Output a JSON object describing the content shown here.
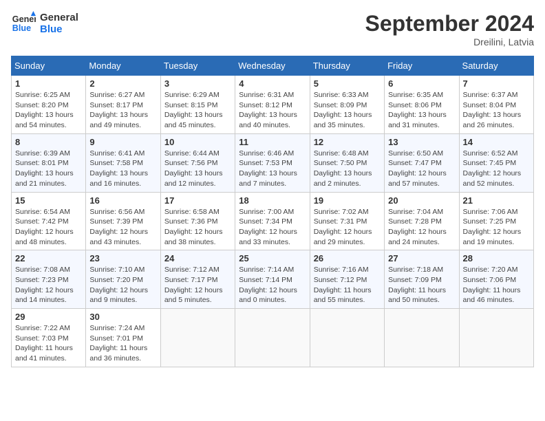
{
  "logo": {
    "line1": "General",
    "line2": "Blue"
  },
  "title": "September 2024",
  "location": "Dreilini, Latvia",
  "days_of_week": [
    "Sunday",
    "Monday",
    "Tuesday",
    "Wednesday",
    "Thursday",
    "Friday",
    "Saturday"
  ],
  "weeks": [
    [
      {
        "day": "1",
        "info": "Sunrise: 6:25 AM\nSunset: 8:20 PM\nDaylight: 13 hours\nand 54 minutes."
      },
      {
        "day": "2",
        "info": "Sunrise: 6:27 AM\nSunset: 8:17 PM\nDaylight: 13 hours\nand 49 minutes."
      },
      {
        "day": "3",
        "info": "Sunrise: 6:29 AM\nSunset: 8:15 PM\nDaylight: 13 hours\nand 45 minutes."
      },
      {
        "day": "4",
        "info": "Sunrise: 6:31 AM\nSunset: 8:12 PM\nDaylight: 13 hours\nand 40 minutes."
      },
      {
        "day": "5",
        "info": "Sunrise: 6:33 AM\nSunset: 8:09 PM\nDaylight: 13 hours\nand 35 minutes."
      },
      {
        "day": "6",
        "info": "Sunrise: 6:35 AM\nSunset: 8:06 PM\nDaylight: 13 hours\nand 31 minutes."
      },
      {
        "day": "7",
        "info": "Sunrise: 6:37 AM\nSunset: 8:04 PM\nDaylight: 13 hours\nand 26 minutes."
      }
    ],
    [
      {
        "day": "8",
        "info": "Sunrise: 6:39 AM\nSunset: 8:01 PM\nDaylight: 13 hours\nand 21 minutes."
      },
      {
        "day": "9",
        "info": "Sunrise: 6:41 AM\nSunset: 7:58 PM\nDaylight: 13 hours\nand 16 minutes."
      },
      {
        "day": "10",
        "info": "Sunrise: 6:44 AM\nSunset: 7:56 PM\nDaylight: 13 hours\nand 12 minutes."
      },
      {
        "day": "11",
        "info": "Sunrise: 6:46 AM\nSunset: 7:53 PM\nDaylight: 13 hours\nand 7 minutes."
      },
      {
        "day": "12",
        "info": "Sunrise: 6:48 AM\nSunset: 7:50 PM\nDaylight: 13 hours\nand 2 minutes."
      },
      {
        "day": "13",
        "info": "Sunrise: 6:50 AM\nSunset: 7:47 PM\nDaylight: 12 hours\nand 57 minutes."
      },
      {
        "day": "14",
        "info": "Sunrise: 6:52 AM\nSunset: 7:45 PM\nDaylight: 12 hours\nand 52 minutes."
      }
    ],
    [
      {
        "day": "15",
        "info": "Sunrise: 6:54 AM\nSunset: 7:42 PM\nDaylight: 12 hours\nand 48 minutes."
      },
      {
        "day": "16",
        "info": "Sunrise: 6:56 AM\nSunset: 7:39 PM\nDaylight: 12 hours\nand 43 minutes."
      },
      {
        "day": "17",
        "info": "Sunrise: 6:58 AM\nSunset: 7:36 PM\nDaylight: 12 hours\nand 38 minutes."
      },
      {
        "day": "18",
        "info": "Sunrise: 7:00 AM\nSunset: 7:34 PM\nDaylight: 12 hours\nand 33 minutes."
      },
      {
        "day": "19",
        "info": "Sunrise: 7:02 AM\nSunset: 7:31 PM\nDaylight: 12 hours\nand 29 minutes."
      },
      {
        "day": "20",
        "info": "Sunrise: 7:04 AM\nSunset: 7:28 PM\nDaylight: 12 hours\nand 24 minutes."
      },
      {
        "day": "21",
        "info": "Sunrise: 7:06 AM\nSunset: 7:25 PM\nDaylight: 12 hours\nand 19 minutes."
      }
    ],
    [
      {
        "day": "22",
        "info": "Sunrise: 7:08 AM\nSunset: 7:23 PM\nDaylight: 12 hours\nand 14 minutes."
      },
      {
        "day": "23",
        "info": "Sunrise: 7:10 AM\nSunset: 7:20 PM\nDaylight: 12 hours\nand 9 minutes."
      },
      {
        "day": "24",
        "info": "Sunrise: 7:12 AM\nSunset: 7:17 PM\nDaylight: 12 hours\nand 5 minutes."
      },
      {
        "day": "25",
        "info": "Sunrise: 7:14 AM\nSunset: 7:14 PM\nDaylight: 12 hours\nand 0 minutes."
      },
      {
        "day": "26",
        "info": "Sunrise: 7:16 AM\nSunset: 7:12 PM\nDaylight: 11 hours\nand 55 minutes."
      },
      {
        "day": "27",
        "info": "Sunrise: 7:18 AM\nSunset: 7:09 PM\nDaylight: 11 hours\nand 50 minutes."
      },
      {
        "day": "28",
        "info": "Sunrise: 7:20 AM\nSunset: 7:06 PM\nDaylight: 11 hours\nand 46 minutes."
      }
    ],
    [
      {
        "day": "29",
        "info": "Sunrise: 7:22 AM\nSunset: 7:03 PM\nDaylight: 11 hours\nand 41 minutes."
      },
      {
        "day": "30",
        "info": "Sunrise: 7:24 AM\nSunset: 7:01 PM\nDaylight: 11 hours\nand 36 minutes."
      },
      null,
      null,
      null,
      null,
      null
    ]
  ]
}
